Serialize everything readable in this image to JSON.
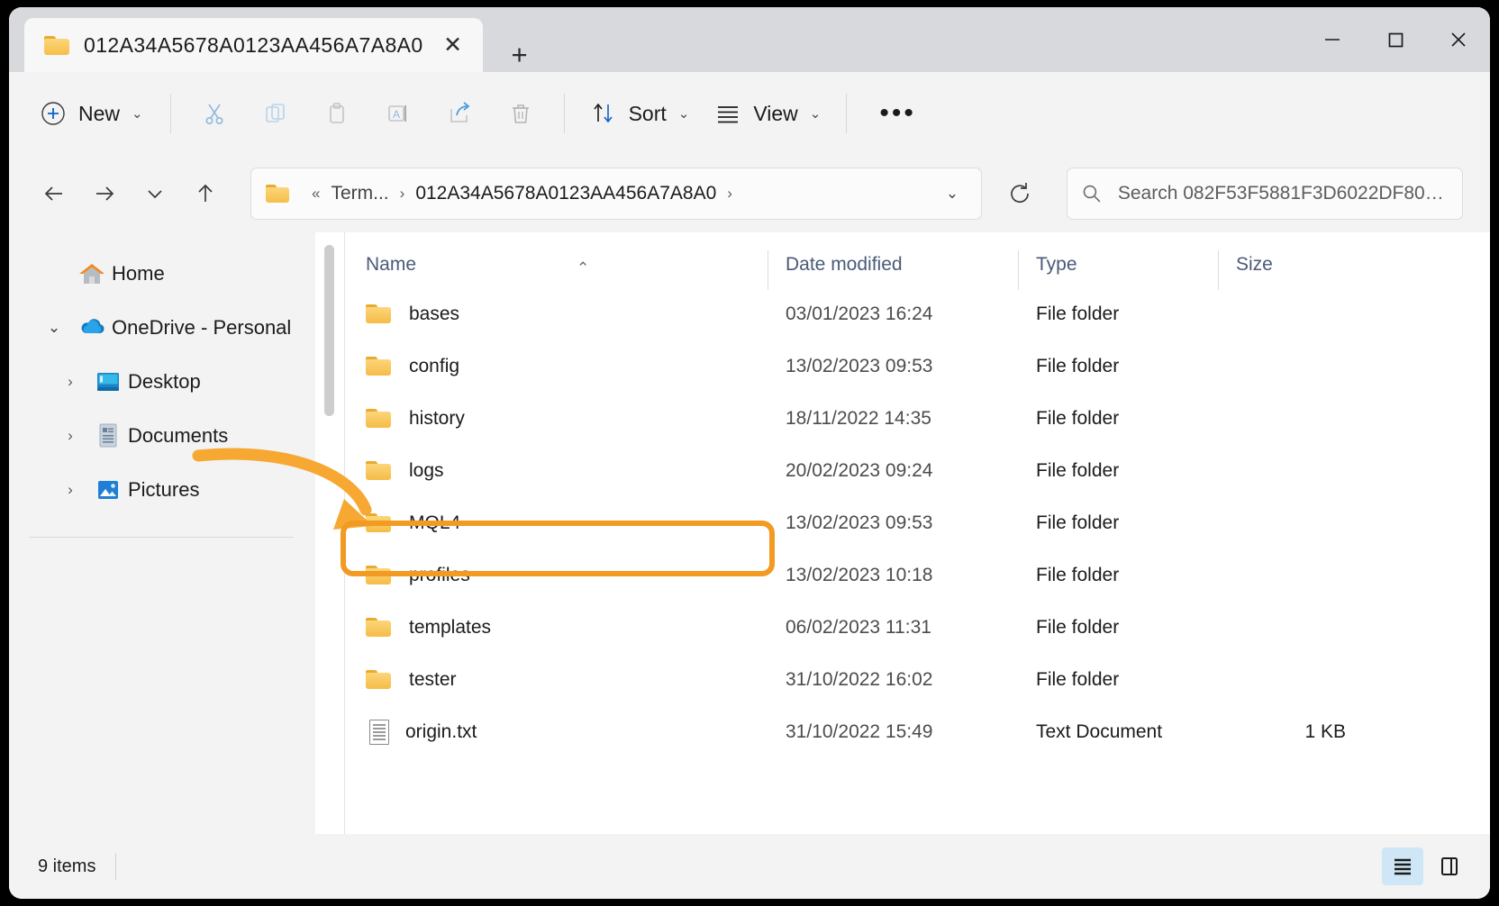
{
  "window": {
    "tab_title": "012A34A5678A0123AA456A7A8A0",
    "tab_close_label": "✕",
    "new_tab_label": "+",
    "minimize_label": "minimize",
    "maximize_label": "maximize",
    "close_label": "close"
  },
  "toolbar": {
    "new_label": "New",
    "new_chevron": "⌄",
    "cut_label": "Cut",
    "copy_label": "Copy",
    "paste_label": "Paste",
    "rename_label": "Rename",
    "share_label": "Share",
    "delete_label": "Delete",
    "sort_label": "Sort",
    "sort_chevron": "⌄",
    "view_label": "View",
    "view_chevron": "⌄",
    "more_label": "•••"
  },
  "nav": {
    "back_label": "Back",
    "forward_label": "Forward",
    "recent_label": "Recent locations",
    "up_label": "Up",
    "refresh_label": "Refresh",
    "breadcrumb": {
      "overflow": "«",
      "parent": "Term...",
      "separator1": "›",
      "current": "012A34A5678A0123AA456A7A8A0",
      "separator2": "›",
      "dropdown": "⌄"
    },
    "search": {
      "placeholder": "Search 082F53F5881F3D6022DF806...",
      "icon": "search-icon"
    }
  },
  "sidebar": {
    "items": [
      {
        "label": "Home",
        "icon": "home-icon",
        "chevron": "",
        "expanded": false,
        "indent": 0
      },
      {
        "label": "OneDrive - Personal",
        "icon": "onedrive-icon",
        "chevron": "⌄",
        "expanded": true,
        "indent": 0
      },
      {
        "label": "Desktop",
        "icon": "desktop-icon",
        "chevron": "›",
        "expanded": false,
        "indent": 1
      },
      {
        "label": "Documents",
        "icon": "documents-icon",
        "chevron": "›",
        "expanded": false,
        "indent": 1
      },
      {
        "label": "Pictures",
        "icon": "pictures-icon",
        "chevron": "›",
        "expanded": false,
        "indent": 1
      }
    ]
  },
  "filelist": {
    "columns": {
      "name": "Name",
      "date_modified": "Date modified",
      "type": "Type",
      "size": "Size"
    },
    "sort_indicator": "⌃",
    "rows": [
      {
        "name": "bases",
        "date": "03/01/2023 16:24",
        "type": "File folder",
        "size": "",
        "icon": "folder-icon",
        "highlighted": false
      },
      {
        "name": "config",
        "date": "13/02/2023 09:53",
        "type": "File folder",
        "size": "",
        "icon": "folder-icon",
        "highlighted": false
      },
      {
        "name": "history",
        "date": "18/11/2022 14:35",
        "type": "File folder",
        "size": "",
        "icon": "folder-icon",
        "highlighted": false
      },
      {
        "name": "logs",
        "date": "20/02/2023 09:24",
        "type": "File folder",
        "size": "",
        "icon": "folder-icon",
        "highlighted": false
      },
      {
        "name": "MQL4",
        "date": "13/02/2023 09:53",
        "type": "File folder",
        "size": "",
        "icon": "folder-icon",
        "highlighted": true
      },
      {
        "name": "profiles",
        "date": "13/02/2023 10:18",
        "type": "File folder",
        "size": "",
        "icon": "folder-icon",
        "highlighted": false
      },
      {
        "name": "templates",
        "date": "06/02/2023 11:31",
        "type": "File folder",
        "size": "",
        "icon": "folder-icon",
        "highlighted": false
      },
      {
        "name": "tester",
        "date": "31/10/2022 16:02",
        "type": "File folder",
        "size": "",
        "icon": "folder-icon",
        "highlighted": false
      },
      {
        "name": "origin.txt",
        "date": "31/10/2022 15:49",
        "type": "Text Document",
        "size": "1 KB",
        "icon": "text-file-icon",
        "highlighted": false
      }
    ]
  },
  "statusbar": {
    "item_count": "9 items",
    "details_view_label": "Details view",
    "pane_view_label": "Preview pane"
  },
  "annotation": {
    "highlight_target": "MQL4",
    "accent_color": "#f29a21",
    "arrow_label": "pointer-arrow-to-MQL4"
  }
}
